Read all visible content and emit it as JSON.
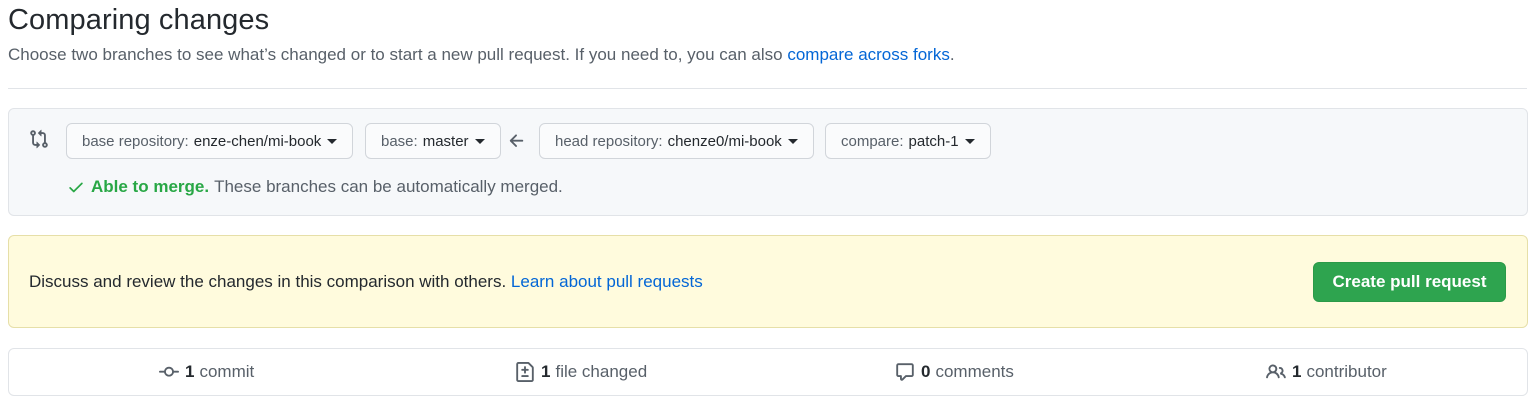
{
  "header": {
    "title": "Comparing changes",
    "subtitle": "Choose two branches to see what’s changed or to start a new pull request. If you need to, you can also ",
    "subtitle_link": "compare across forks",
    "subtitle_end": "."
  },
  "range": {
    "base_repo_label": "base repository:",
    "base_repo_value": "enze-chen/mi-book",
    "base_label": "base:",
    "base_value": "master",
    "head_repo_label": "head repository:",
    "head_repo_value": "chenze0/mi-book",
    "compare_label": "compare:",
    "compare_value": "patch-1",
    "merge_ok": "Able to merge.",
    "merge_text": "These branches can be automatically merged."
  },
  "flash": {
    "text": "Discuss and review the changes in this comparison with others. ",
    "link": "Learn about pull requests",
    "button": "Create pull request"
  },
  "summary": {
    "commits_count": "1",
    "commits_label": "commit",
    "files_count": "1",
    "files_label": "file changed",
    "comments_count": "0",
    "comments_label": "comments",
    "contributors_count": "1",
    "contributors_label": "contributor"
  },
  "colors": {
    "link": "#0366d6",
    "success": "#28a745",
    "primary_button": "#2ea44f",
    "flash_bg": "#fffbdd"
  }
}
